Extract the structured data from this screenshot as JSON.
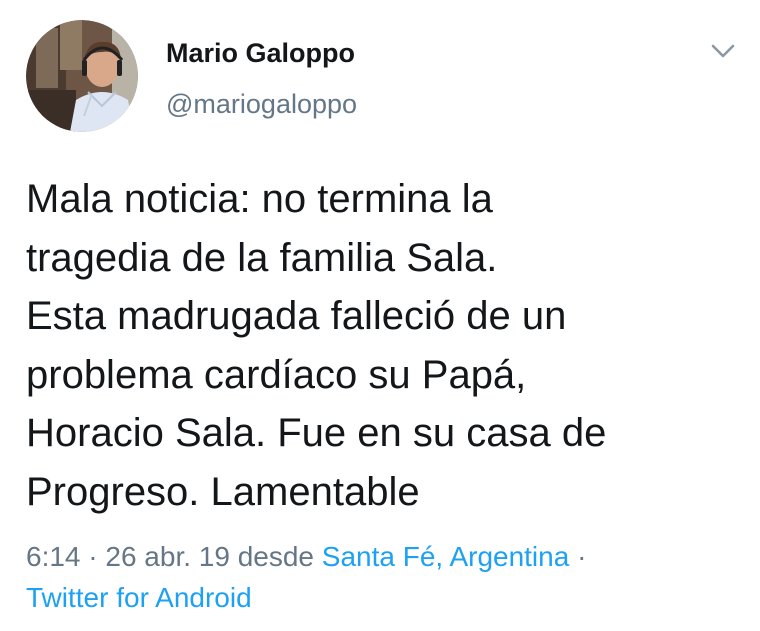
{
  "tweet": {
    "author": {
      "display_name": "Mario Galoppo",
      "handle": "@mariogaloppo",
      "avatar_icon": "profile-photo"
    },
    "menu_icon": "chevron-down-icon",
    "text_lines": [
      "Mala noticia: no termina la",
      "tragedia de la familia Sala.",
      "Esta madrugada falleció de un",
      "problema cardíaco su Papá,",
      "Horacio Sala. Fue en su casa de",
      "Progreso. Lamentable"
    ],
    "meta": {
      "time_date": "6:14 · 26 abr. 19",
      "from_label": "desde",
      "location": "Santa Fé, Argentina",
      "separator": "·",
      "source": "Twitter for Android"
    }
  },
  "colors": {
    "text": "#14171a",
    "secondary": "#657786",
    "link": "#1da1f2",
    "background": "#ffffff"
  }
}
